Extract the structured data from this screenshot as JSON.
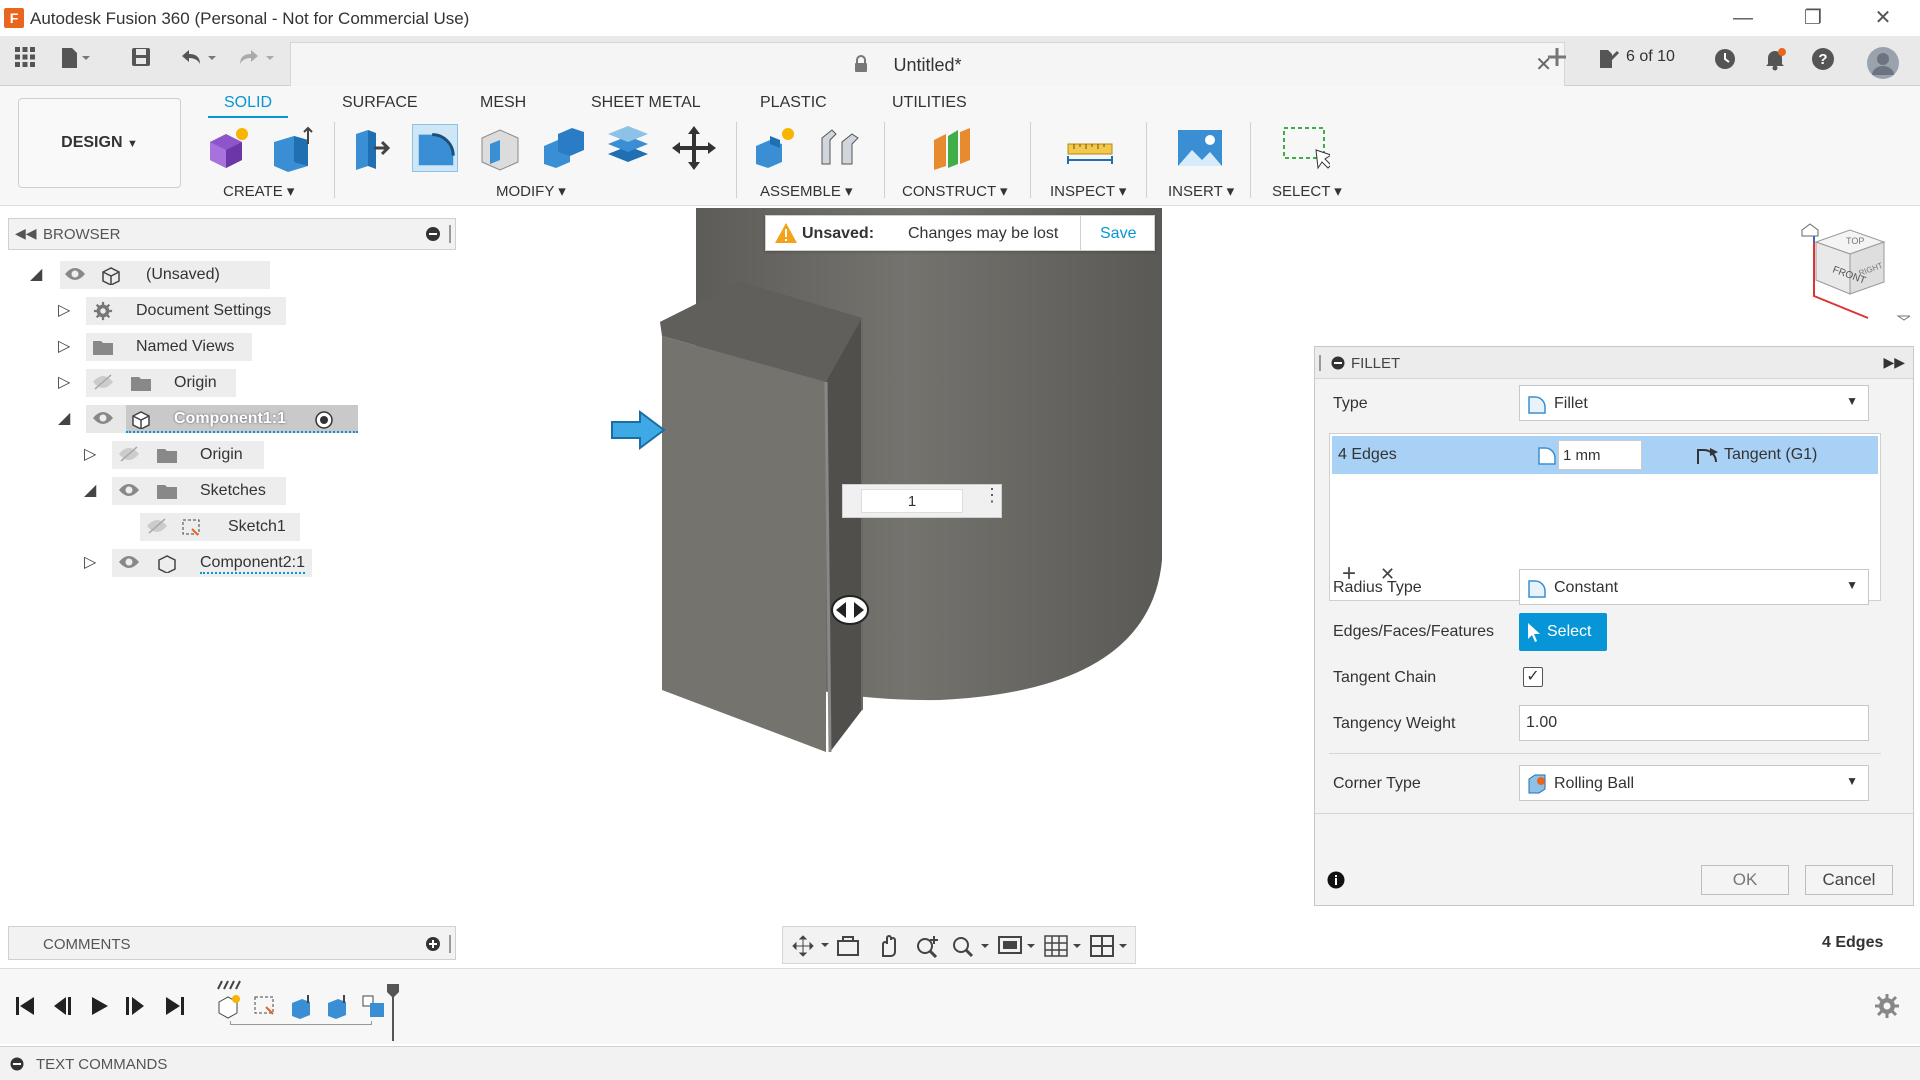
{
  "window": {
    "title": "Autodesk Fusion 360 (Personal - Not for Commercial Use)",
    "app_icon_letter": "F"
  },
  "tabbar": {
    "doc_title": "Untitled*",
    "job_status": "6 of 10"
  },
  "ribbon": {
    "workspace": "DESIGN",
    "tabs": [
      "SOLID",
      "SURFACE",
      "MESH",
      "SHEET METAL",
      "PLASTIC",
      "UTILITIES"
    ],
    "groups": {
      "create": "CREATE",
      "modify": "MODIFY",
      "assemble": "ASSEMBLE",
      "construct": "CONSTRUCT",
      "inspect": "INSPECT",
      "insert": "INSERT",
      "select": "SELECT"
    }
  },
  "browser": {
    "title": "BROWSER",
    "root": "(Unsaved)",
    "items": [
      "Document Settings",
      "Named Views",
      "Origin",
      "Component1:1",
      "Origin",
      "Sketches",
      "Sketch1",
      "Component2:1"
    ]
  },
  "unsaved_banner": {
    "label": "Unsaved:",
    "message": "Changes may be lost",
    "action": "Save"
  },
  "viewport": {
    "manipulator_value": "1",
    "viewcube_front": "FRONT",
    "viewcube_top": "TOP",
    "viewcube_right": "RIGHT"
  },
  "fillet": {
    "title": "FILLET",
    "type_label": "Type",
    "type_value": "Fillet",
    "selection_count": "4 Edges",
    "radius_value": "1 mm",
    "continuity": "Tangent (G1)",
    "radius_type_label": "Radius Type",
    "radius_type_value": "Constant",
    "edges_label": "Edges/Faces/Features",
    "select_button": "Select",
    "tangent_chain_label": "Tangent Chain",
    "tangent_chain_checked": true,
    "tangency_weight_label": "Tangency Weight",
    "tangency_weight_value": "1.00",
    "corner_type_label": "Corner Type",
    "corner_type_value": "Rolling Ball",
    "ok": "OK",
    "cancel": "Cancel"
  },
  "status": {
    "selection": "4 Edges"
  },
  "comments": {
    "title": "COMMENTS"
  },
  "text_commands": {
    "title": "TEXT COMMANDS"
  },
  "colors": {
    "accent": "#0696d7",
    "selection_row": "#a9d0f5",
    "model_body": "#6e6d69",
    "select_button": "#0696d7"
  }
}
